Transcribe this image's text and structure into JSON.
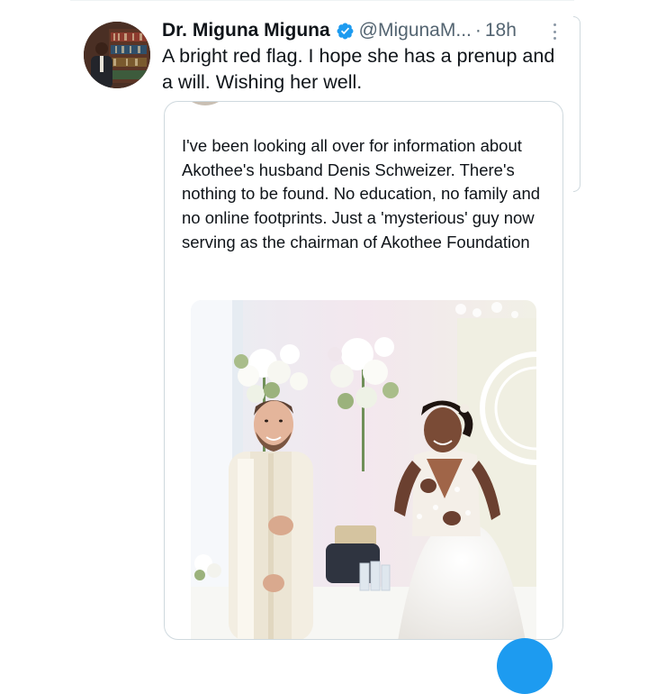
{
  "tweet": {
    "display_name": "Dr. Miguna Miguna",
    "handle": "@MigunaM...",
    "separator": "·",
    "time": "18h",
    "text": "A bright red flag. I hope she has a prenup and a will. Wishing her well."
  },
  "quoted_tweet": {
    "text": "I've been looking all over for information about Akothee's husband Denis Schweizer. There's nothing to be found. No education, no family and no online footprints. Just a 'mysterious' guy now serving as the chairman of Akothee Foundation"
  },
  "icons": {
    "verified": "verified-badge-icon",
    "more": "more-options-icon"
  },
  "colors": {
    "accent": "#1d9bf0",
    "text_primary": "#0f1419",
    "text_secondary": "#536471",
    "border": "#cfd9de"
  }
}
